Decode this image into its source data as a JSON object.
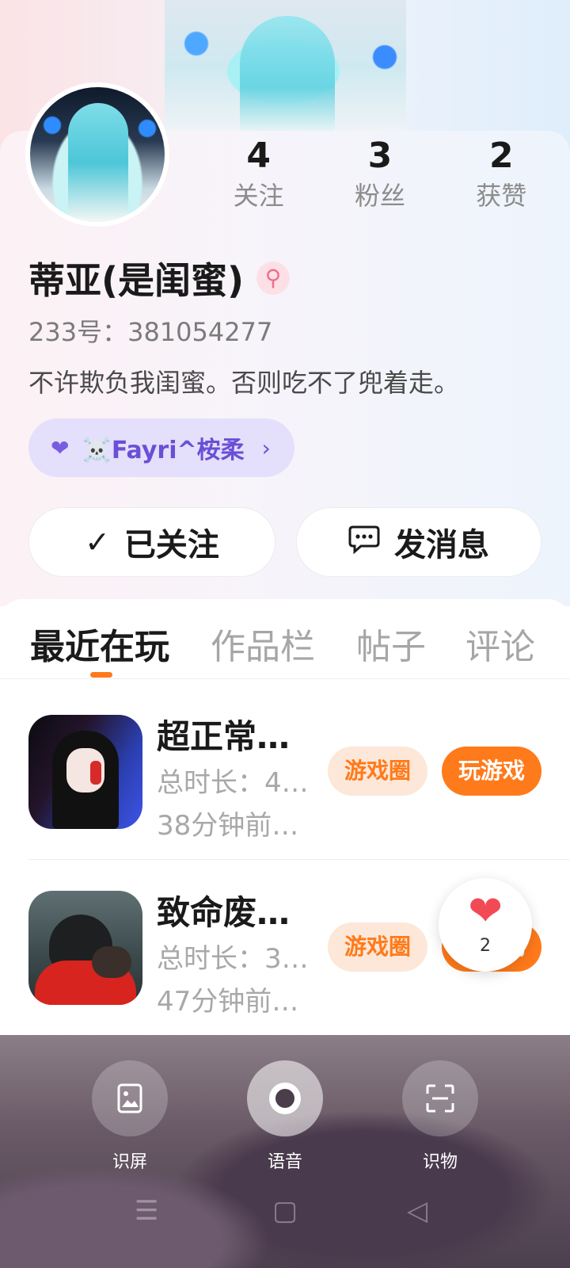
{
  "profile": {
    "stats": [
      {
        "value": "4",
        "label": "关注"
      },
      {
        "value": "3",
        "label": "粉丝"
      },
      {
        "value": "2",
        "label": "获赞"
      }
    ],
    "name": "蒂亚(是闺蜜)",
    "gender_symbol": "⚲",
    "uid": "233号：381054277",
    "bio": "不许欺负我闺蜜。否则吃不了兜着走。",
    "friend_chip": {
      "heart": "❤",
      "name": "☠️Fayri^桉柔",
      "chevron": "›"
    },
    "follow_button": {
      "icon": "✓",
      "label": "已关注"
    },
    "message_button": {
      "icon": "💬",
      "label": "发消息"
    }
  },
  "tabs": [
    {
      "label": "最近在玩",
      "active": true
    },
    {
      "label": "作品栏",
      "active": false
    },
    {
      "label": "帖子",
      "active": false
    },
    {
      "label": "评论",
      "active": false
    }
  ],
  "games": [
    {
      "title": "超正常…",
      "duration": "总时长：4…",
      "last_played": "38分钟前…",
      "circle_label": "游戏圈",
      "play_label": "玩游戏"
    },
    {
      "title": "致命废…",
      "duration": "总时长：3…",
      "last_played": "47分钟前…",
      "circle_label": "游戏圈",
      "play_label": "玩游戏"
    }
  ],
  "like_bubble": {
    "icon": "❤",
    "count": "2"
  },
  "assistant_tools": [
    {
      "label": "识屏",
      "icon": "screen-image-icon"
    },
    {
      "label": "语音",
      "icon": "voice-icon"
    },
    {
      "label": "识物",
      "icon": "scan-icon"
    }
  ],
  "colors": {
    "accent": "#ff7a1a",
    "chip_text": "#6a4fd6",
    "chip_bg": "#e4dffa"
  }
}
